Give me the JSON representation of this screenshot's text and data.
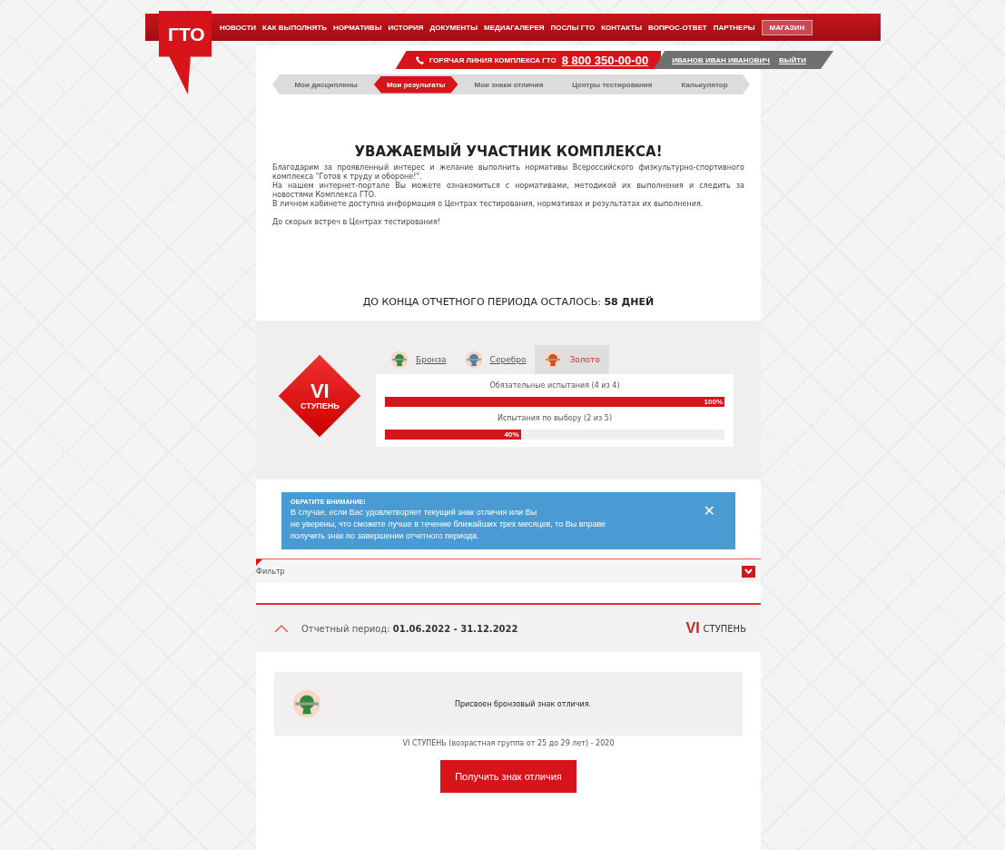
{
  "logo": {
    "text": "ГТО"
  },
  "nav": {
    "items": [
      "НОВОСТИ",
      "КАК ВЫПОЛНЯТЬ",
      "НОРМАТИВЫ",
      "ИСТОРИЯ",
      "ДОКУМЕНТЫ",
      "МЕДИАГАЛЕРЕЯ",
      "ПОСЛЫ ГТО",
      "КОНТАКТЫ",
      "ВОПРОС-ОТВЕТ",
      "ПАРТНЕРЫ"
    ],
    "shop": "МАГАЗИН"
  },
  "hotline": {
    "label": "ГОРЯЧАЯ ЛИНИЯ КОМПЛЕКСА ГТО",
    "phone": "8 800 350-00-00",
    "user": "ИВАНОВ ИВАН ИВАНОВИЧ",
    "logout": "ВЫЙТИ"
  },
  "tabs": [
    {
      "label": "Мои дисциплины",
      "selected": false
    },
    {
      "label": "Мои результаты",
      "selected": true
    },
    {
      "label": "Мои знаки отличия",
      "selected": false
    },
    {
      "label": "Центры тестирования",
      "selected": false
    },
    {
      "label": "Калькулятор",
      "selected": false
    }
  ],
  "welcome": {
    "title": "УВАЖАЕМЫЙ УЧАСТНИК КОМПЛЕКСА!",
    "paragraphs": [
      "Благодарим за проявленный интерес и желание выполнить нормативы Всероссийского физкультурно-спортивного комплекса \"Готов к труду и обороне!\".",
      "На нашем интернет-портале Вы можете ознакомиться с нормативами, методикой их выполнения и следить за новостями Комплекса ГТО.",
      "В личном кабинете доступна информация о Центрах тестирования, нормативах и результатах их выполнения.",
      "До скорых встреч в Центрах тестирования!"
    ]
  },
  "countdown": "ДО КОНЦА ОТЧЕТНОГО ПЕРИОДА ОСТАЛОСЬ: **58 ДНЕЙ**",
  "stage": {
    "numeral": "VI",
    "label": "СТУПЕНЬ"
  },
  "badges": [
    {
      "label": "Бронза",
      "color": "#2e8b3c",
      "selected": false
    },
    {
      "label": "Серебро",
      "color": "#4a7fa8",
      "selected": false
    },
    {
      "label": "Золото",
      "color": "#e04a1a",
      "selected": true
    }
  ],
  "progress": [
    {
      "label": "Обязательные испытания (4 из 4)",
      "level": 1.0,
      "reading": "100%"
    },
    {
      "label": "Испытания по выбору (2 из 5)",
      "level": 0.4,
      "reading": "40%"
    }
  ],
  "notice": {
    "title": "ОБРАТИТЕ ВНИМАНИЕ!",
    "lines": [
      "В случае, если Вас удовлетворяет текущий знак отличия  или Вы",
      "не уверены, что сможете лучше в течение ближайших трех месяцев, то Вы вправе",
      "получить  знак  по  завершении отчетного периода."
    ],
    "close": "✕"
  },
  "filter": {
    "label": "Фильтр",
    "expanded": false
  },
  "period": {
    "label": "Отчетный период:",
    "dates": "01.06.2022 - 31.12.2022",
    "numeral": "VI",
    "stage": "СТУПЕНЬ",
    "expanded": true
  },
  "award": {
    "text": "Присвоен бронзовый знак отличия.",
    "caption": "VI СТУПЕНЬ (возрастная группа от 25 до 29 лет) - 2020",
    "button": "Получить знак отличия"
  }
}
